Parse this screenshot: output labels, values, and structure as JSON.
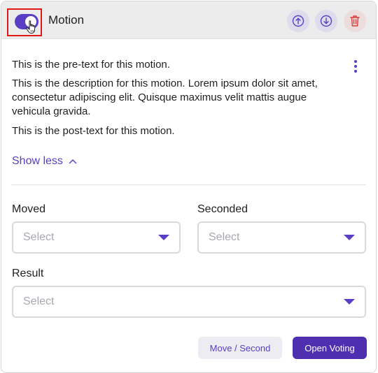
{
  "header": {
    "title": "Motion",
    "toggle_on": true,
    "icons": [
      "arrow-up-circle-icon",
      "arrow-down-circle-icon",
      "trash-icon"
    ]
  },
  "content": {
    "pre_text": "This is the pre-text for this motion.",
    "description": "This is the description for this motion. Lorem ipsum dolor sit amet, consectetur adipiscing elit. Quisque maximus velit mattis augue vehicula gravida.",
    "post_text": "This is the post-text for this motion.",
    "show_less_label": "Show less"
  },
  "form": {
    "moved_label": "Moved",
    "moved_placeholder": "Select",
    "seconded_label": "Seconded",
    "seconded_placeholder": "Select",
    "result_label": "Result",
    "result_placeholder": "Select"
  },
  "actions": {
    "move_second_label": "Move / Second",
    "open_voting_label": "Open Voting"
  },
  "colors": {
    "accent": "#5a3fc4",
    "primary_button": "#4e2fb0",
    "danger": "#d93a3a",
    "highlight_frame": "#e01818"
  }
}
